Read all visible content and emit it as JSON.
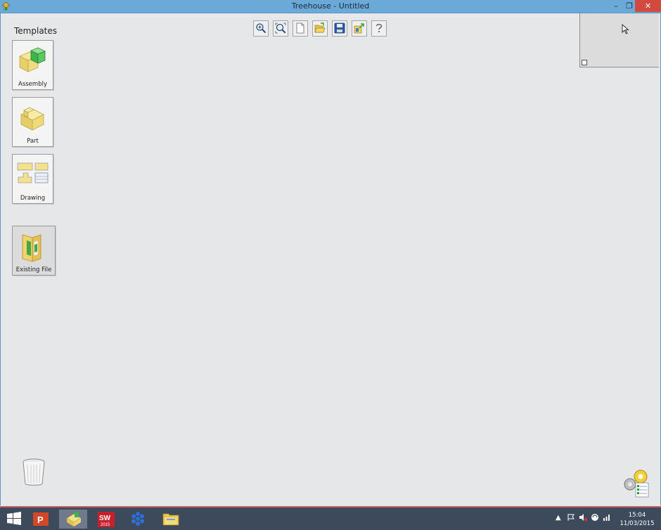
{
  "window": {
    "title": "Treehouse - Untitled",
    "min_label": "–",
    "max_label": "❐",
    "close_label": "✕"
  },
  "templates": {
    "heading": "Templates",
    "items": [
      {
        "label": "Assembly"
      },
      {
        "label": "Part"
      },
      {
        "label": "Drawing"
      }
    ],
    "existing_label": "Existing File"
  },
  "toolbar": {
    "icons": [
      "zoom-in-icon",
      "zoom-fit-icon",
      "new-document-icon",
      "open-folder-icon",
      "save-icon",
      "export-icon",
      "help-icon"
    ]
  },
  "taskbar": {
    "time": "15:04",
    "date": "11/03/2015",
    "items": [
      "windows-start-icon",
      "powerpoint-icon",
      "treehouse-icon",
      "solidworks-2015-icon",
      "snowflake-app-icon",
      "file-explorer-icon"
    ],
    "tray_caret": "▲"
  },
  "colors": {
    "titlebar": "#6aa9d8",
    "canvas": "#e6e7e9",
    "taskbar": "#3d4a5c",
    "close": "#d24a3f"
  }
}
